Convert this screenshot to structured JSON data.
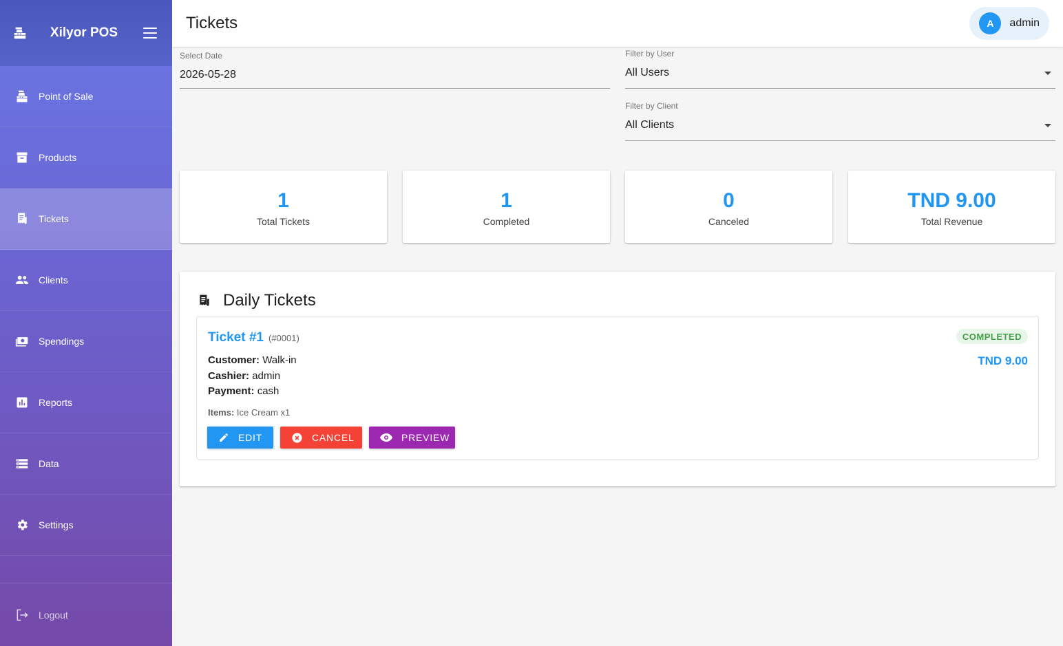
{
  "app": {
    "brand": "Xilyor POS"
  },
  "sidebar": {
    "items": [
      {
        "label": "Point of Sale",
        "icon": "cash-register-icon"
      },
      {
        "label": "Products",
        "icon": "archive-box-icon"
      },
      {
        "label": "Tickets",
        "icon": "receipt-icon",
        "active": true
      },
      {
        "label": "Clients",
        "icon": "people-icon"
      },
      {
        "label": "Spendings",
        "icon": "money-icon"
      },
      {
        "label": "Reports",
        "icon": "bar-chart-icon"
      },
      {
        "label": "Data",
        "icon": "storage-icon"
      },
      {
        "label": "Settings",
        "icon": "gear-icon"
      }
    ],
    "logout": "Logout"
  },
  "header": {
    "title": "Tickets",
    "user": {
      "initial": "A",
      "name": "admin"
    }
  },
  "filters": {
    "date": {
      "label": "Select Date",
      "value": "2026-05-28"
    },
    "user": {
      "label": "Filter by User",
      "value": "All Users"
    },
    "client": {
      "label": "Filter by Client",
      "value": "All Clients"
    }
  },
  "stats": [
    {
      "value": "1",
      "caption": "Total Tickets"
    },
    {
      "value": "1",
      "caption": "Completed"
    },
    {
      "value": "0",
      "caption": "Canceled"
    },
    {
      "value": "TND 9.00",
      "caption": "Total Revenue"
    }
  ],
  "daily": {
    "title": "Daily Tickets",
    "tickets": [
      {
        "name": "Ticket #1",
        "number": "(#0001)",
        "status": "COMPLETED",
        "total": "TND 9.00",
        "customer_label": "Customer:",
        "customer": "Walk-in",
        "cashier_label": "Cashier:",
        "cashier": "admin",
        "payment_label": "Payment:",
        "payment": "cash",
        "items_label": "Items:",
        "items": "Ice Cream x1",
        "actions": {
          "edit": "EDIT",
          "cancel": "CANCEL",
          "preview": "PREVIEW"
        }
      }
    ]
  },
  "colors": {
    "accent": "#2196f3",
    "danger": "#f44336",
    "purple": "#9c27b0",
    "success": "#43a047"
  }
}
